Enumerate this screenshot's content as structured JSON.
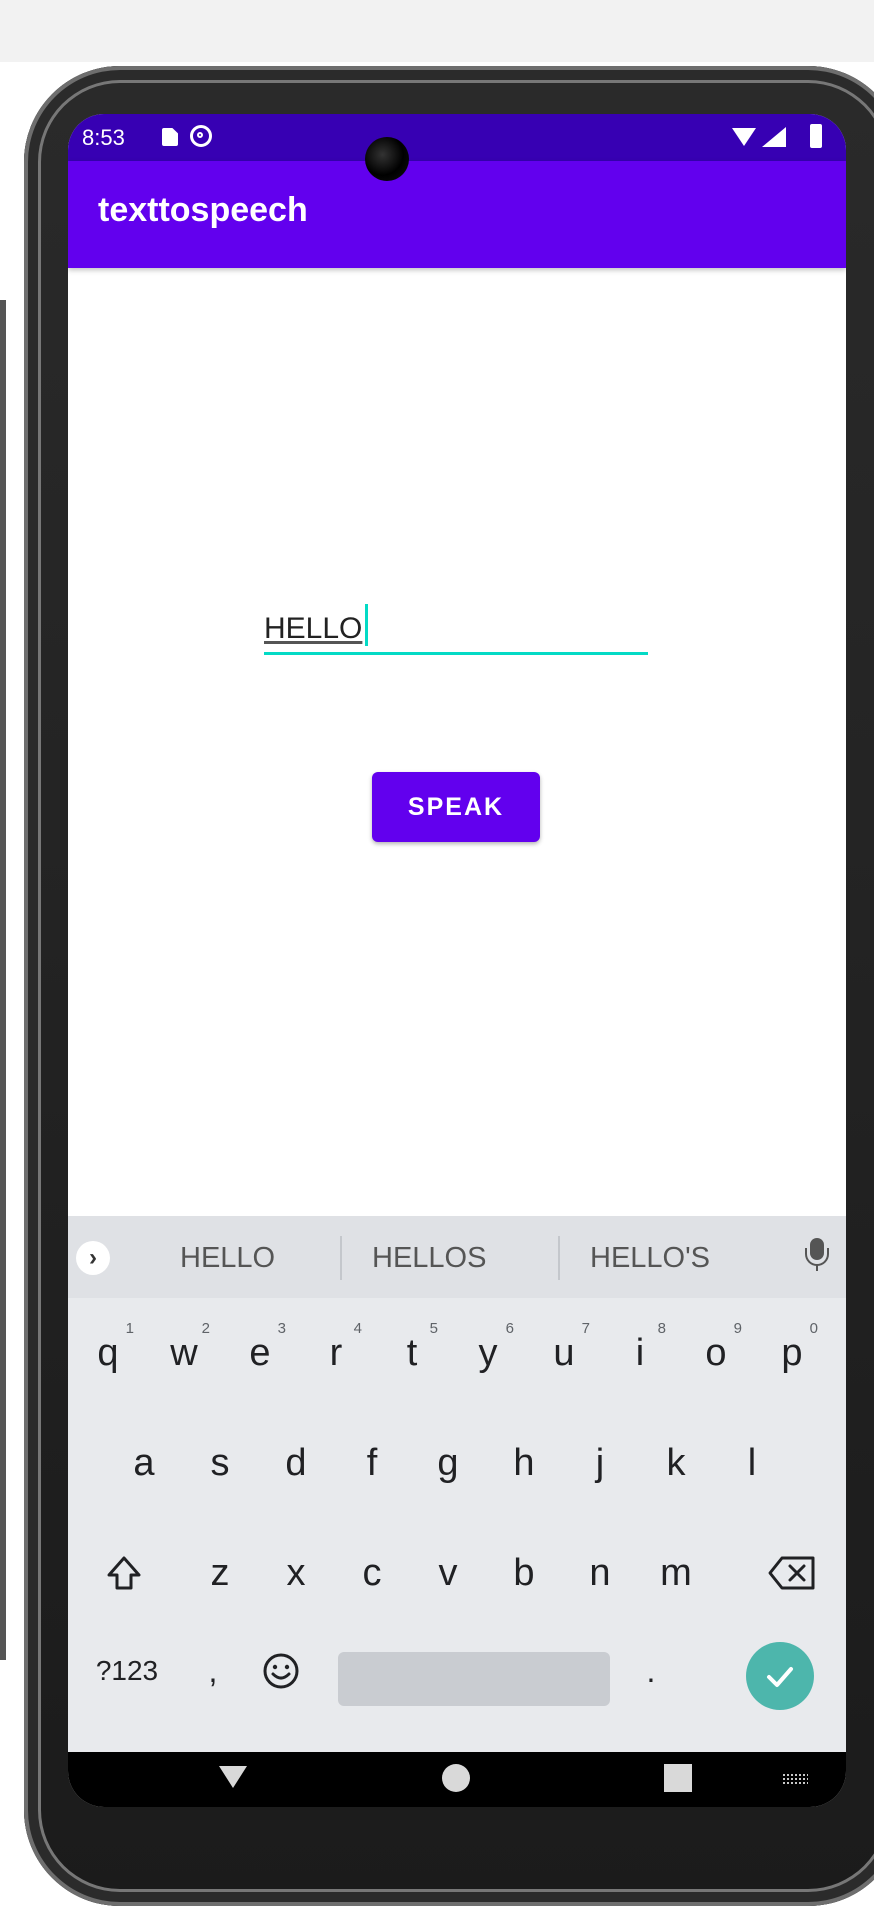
{
  "status_bar": {
    "time": "8:53",
    "icons": [
      "sd-card-icon",
      "at-sign-icon",
      "wifi-icon",
      "signal-icon",
      "battery-icon"
    ]
  },
  "app_bar": {
    "title": "texttospeech"
  },
  "text_input": {
    "value": "HELLO"
  },
  "speak_button": {
    "label": "SPEAK"
  },
  "keyboard": {
    "suggestions": [
      "HELLO",
      "HELLOS",
      "HELLO'S"
    ],
    "row1": [
      {
        "key": "q",
        "hint": "1"
      },
      {
        "key": "w",
        "hint": "2"
      },
      {
        "key": "e",
        "hint": "3"
      },
      {
        "key": "r",
        "hint": "4"
      },
      {
        "key": "t",
        "hint": "5"
      },
      {
        "key": "y",
        "hint": "6"
      },
      {
        "key": "u",
        "hint": "7"
      },
      {
        "key": "i",
        "hint": "8"
      },
      {
        "key": "o",
        "hint": "9"
      },
      {
        "key": "p",
        "hint": "0"
      }
    ],
    "row2": [
      "a",
      "s",
      "d",
      "f",
      "g",
      "h",
      "j",
      "k",
      "l"
    ],
    "row3": [
      "z",
      "x",
      "c",
      "v",
      "b",
      "n",
      "m"
    ],
    "symbols_label": "?123",
    "comma": ",",
    "period": "."
  },
  "colors": {
    "status_bar": "#3700b3",
    "primary": "#6200ee",
    "accent": "#03dac5",
    "enter": "#4db6ac"
  }
}
